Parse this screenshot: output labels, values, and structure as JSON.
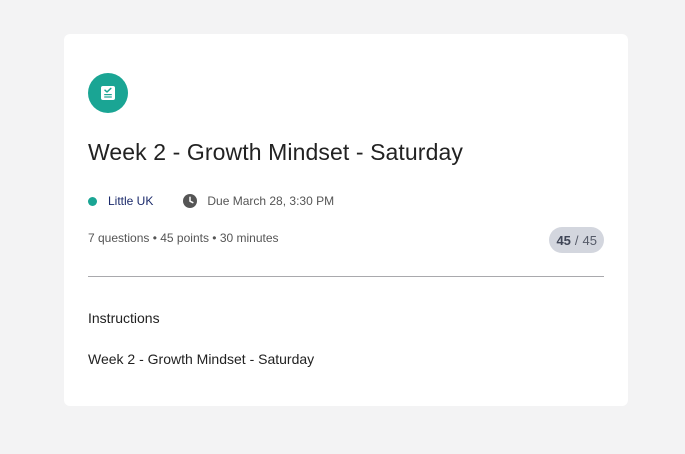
{
  "assignment": {
    "icon": "assignment-check-icon",
    "title": "Week 2 - Growth Mindset - Saturday",
    "class_name": "Little UK",
    "due": "Due March 28, 3:30 PM",
    "details": "7 questions • 45 points • 30 minutes",
    "score": {
      "earned": "45",
      "separator": "/",
      "total": "45"
    }
  },
  "instructions": {
    "heading": "Instructions",
    "body": "Week 2 - Growth Mindset - Saturday"
  },
  "colors": {
    "accent": "#1aa594",
    "class_name": "#1b2a6b",
    "badge_bg": "#d3d6de",
    "page_bg": "#f3f3f4"
  }
}
